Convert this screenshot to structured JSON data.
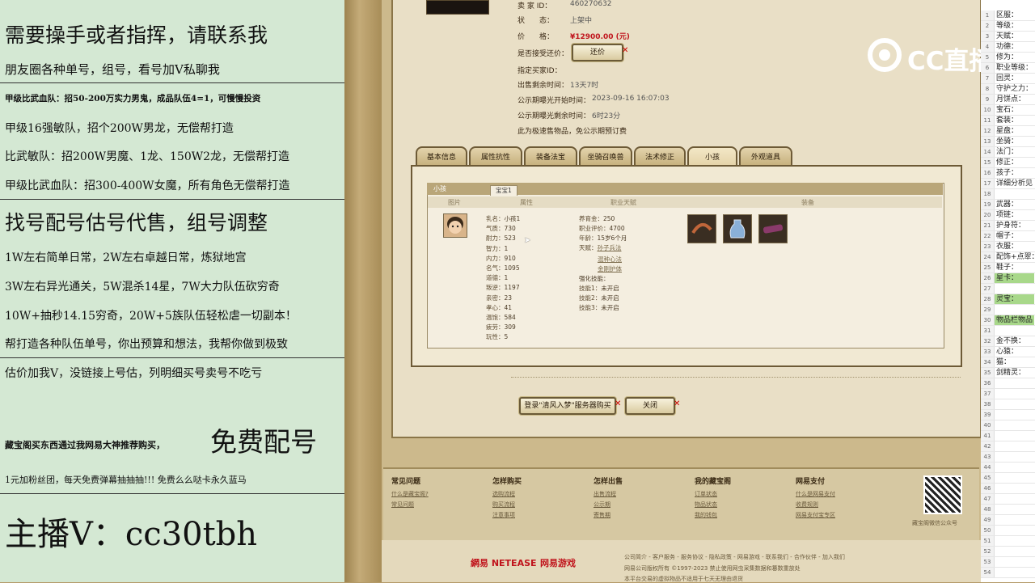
{
  "overlay": {
    "lines": [
      "需要操手或者指挥，请联系我",
      "朋友圈各种单号，组号，看号加V私聊我",
      "甲级比武血队：招50-200万实力男鬼，成品队伍4=1，可慢慢投资",
      "甲级16强敏队，招个200W男龙，无偿帮打造",
      "比武敏队：招200W男魔、1龙、150W2龙，无偿帮打造",
      "甲级比武血队：招300-400W女魔，所有角色无偿帮打造",
      "找号配号估号代售，组号调整",
      "1W左右简单日常，2W左右卓越日常，炼狱地宫",
      "3W左右异光通关，5W混杀14星，7W大力队伍砍穷奇",
      "10W+抽秒14.15穷奇，20W+5族队伍轻松虐一切副本！",
      "帮打造各种队伍单号，你出预算和想法，我帮你做到极致",
      "估价加我V，没链接上号估，列明细买号卖号不吃亏",
      "藏宝阁买东西通过我网易大神推荐购买，",
      "免费配号",
      "1元加粉丝团，每天免费弹幕抽抽抽!!! 免费么么哒卡永久蓝马",
      "主播V：cc30tbh"
    ]
  },
  "watermark": "CC直播",
  "listing": {
    "seller_id_label": "卖 家 ID：",
    "seller_id": "460270632",
    "status_label": "状　　态：",
    "status": "上架中",
    "price_label": "价　　格：",
    "price": "¥12900.00 (元)",
    "bargain_label": "是否接受还价：",
    "bargain_button": "还价",
    "buyer_label": "指定买家ID：",
    "time_left_label": "出售剩余时间：",
    "time_left": "13天7时",
    "public_start_label": "公示期曝光开始时间：",
    "public_start": "2023-09-16 16:07:03",
    "public_left_label": "公示期曝光剩余时间：",
    "public_left": "6时23分",
    "note": "此为极速售物品，免公示期预订费"
  },
  "tabs": [
    "基本信息",
    "属性抗性",
    "装备法宝",
    "坐骑召唤兽",
    "法术修正",
    "小孩",
    "外观道具"
  ],
  "child": {
    "section_title": "小孩",
    "sub_tab": "宝宝1",
    "columns": [
      "图片",
      "属性",
      "职业天赋",
      "装备"
    ],
    "stats": [
      {
        "k": "乳名：",
        "v": "小孩1"
      },
      {
        "k": "气质：",
        "v": "730"
      },
      {
        "k": "耐力：",
        "v": "523"
      },
      {
        "k": "智力：",
        "v": "1"
      },
      {
        "k": "内力：",
        "v": "910"
      },
      {
        "k": "名气：",
        "v": "1095"
      },
      {
        "k": "道德：",
        "v": "1"
      },
      {
        "k": "叛逆：",
        "v": "1197"
      },
      {
        "k": "亲密：",
        "v": "23"
      },
      {
        "k": "孝心：",
        "v": "41"
      },
      {
        "k": "温饱：",
        "v": "584"
      },
      {
        "k": "疲劳：",
        "v": "309"
      },
      {
        "k": "玩性：",
        "v": "5"
      }
    ],
    "career": [
      {
        "k": "养育金：",
        "v": "250"
      },
      {
        "k": "职业评价：",
        "v": "4700"
      },
      {
        "k": "年龄：",
        "v": "15岁6个月"
      },
      {
        "k": "天赋：",
        "v": "孙子兵法"
      }
    ],
    "talents_extra": [
      "混种心法",
      "金刚护体"
    ],
    "skill_title": "强化技能：",
    "skills": [
      {
        "k": "技能1：",
        "v": "未开启"
      },
      {
        "k": "技能2：",
        "v": "未开启"
      },
      {
        "k": "技能3：",
        "v": "未开启"
      }
    ]
  },
  "actions": {
    "login_buy": "登录\"清风入梦\"服务器购买",
    "close": "关闭"
  },
  "footer": {
    "cols": [
      {
        "title": "常见问题",
        "links": [
          "什么是藏宝阁?",
          "常见问题"
        ]
      },
      {
        "title": "怎样购买",
        "links": [
          "选购流程",
          "购买流程",
          "注意事项"
        ]
      },
      {
        "title": "怎样出售",
        "links": [
          "出售流程",
          "公示期",
          "寄售期"
        ]
      },
      {
        "title": "我的藏宝阁",
        "links": [
          "订单状态",
          "物品状态",
          "我的钱包"
        ]
      },
      {
        "title": "网易支付",
        "links": [
          "什么是网易支付",
          "收费规则",
          "网易支付宝专区"
        ]
      }
    ],
    "qr_caption": "藏宝阁微信公众号"
  },
  "bottom": {
    "brand1": "網易 NETEASE",
    "brand2": "网易游戏",
    "links": "公司简介 - 客户服务 - 服务协议 - 隐私政策 - 网易游戏 - 联系我们 - 合作伙伴 - 加入我们",
    "copy1": "网易公司版权所有 ©1997-2023  禁止使用网虫采集数据和篡数重放处",
    "copy2": "本平台交易的虚拟物品不适用于七天无理由退货"
  },
  "sheet": {
    "rows": [
      {
        "n": "1",
        "t": "区服："
      },
      {
        "n": "2",
        "t": "等级："
      },
      {
        "n": "3",
        "t": "天赋："
      },
      {
        "n": "4",
        "t": "功德："
      },
      {
        "n": "5",
        "t": "修为："
      },
      {
        "n": "6",
        "t": "职业等级："
      },
      {
        "n": "7",
        "t": "回灵："
      },
      {
        "n": "8",
        "t": "守护之力："
      },
      {
        "n": "9",
        "t": "月饼点："
      },
      {
        "n": "10",
        "t": "宝石："
      },
      {
        "n": "11",
        "t": "套装："
      },
      {
        "n": "12",
        "t": "星盘："
      },
      {
        "n": "13",
        "t": "坐骑："
      },
      {
        "n": "14",
        "t": "法门："
      },
      {
        "n": "15",
        "t": "修正："
      },
      {
        "n": "16",
        "t": "孩子："
      },
      {
        "n": "17",
        "t": "详细分析见"
      },
      {
        "n": "18",
        "t": ""
      },
      {
        "n": "19",
        "t": "武器："
      },
      {
        "n": "20",
        "t": "项链："
      },
      {
        "n": "21",
        "t": "护身符："
      },
      {
        "n": "22",
        "t": "帽子："
      },
      {
        "n": "23",
        "t": "衣服："
      },
      {
        "n": "24",
        "t": "配饰+点翠："
      },
      {
        "n": "25",
        "t": "鞋子："
      },
      {
        "n": "26",
        "t": "星卡：",
        "hl": true
      },
      {
        "n": "27",
        "t": ""
      },
      {
        "n": "28",
        "t": "灵宝：",
        "hl": true
      },
      {
        "n": "29",
        "t": ""
      },
      {
        "n": "30",
        "t": "物品栏物品",
        "hl": true
      },
      {
        "n": "31",
        "t": ""
      },
      {
        "n": "32",
        "t": "金不换："
      },
      {
        "n": "33",
        "t": "心猿："
      },
      {
        "n": "34",
        "t": "猫："
      },
      {
        "n": "35",
        "t": "剑精灵："
      },
      {
        "n": "36",
        "t": ""
      },
      {
        "n": "37",
        "t": ""
      },
      {
        "n": "38",
        "t": ""
      },
      {
        "n": "39",
        "t": ""
      },
      {
        "n": "40",
        "t": ""
      },
      {
        "n": "41",
        "t": ""
      },
      {
        "n": "42",
        "t": ""
      },
      {
        "n": "43",
        "t": ""
      },
      {
        "n": "44",
        "t": ""
      },
      {
        "n": "45",
        "t": ""
      },
      {
        "n": "46",
        "t": ""
      },
      {
        "n": "47",
        "t": ""
      },
      {
        "n": "48",
        "t": ""
      },
      {
        "n": "49",
        "t": ""
      },
      {
        "n": "50",
        "t": ""
      },
      {
        "n": "51",
        "t": ""
      },
      {
        "n": "52",
        "t": ""
      },
      {
        "n": "53",
        "t": ""
      },
      {
        "n": "54",
        "t": ""
      }
    ]
  }
}
